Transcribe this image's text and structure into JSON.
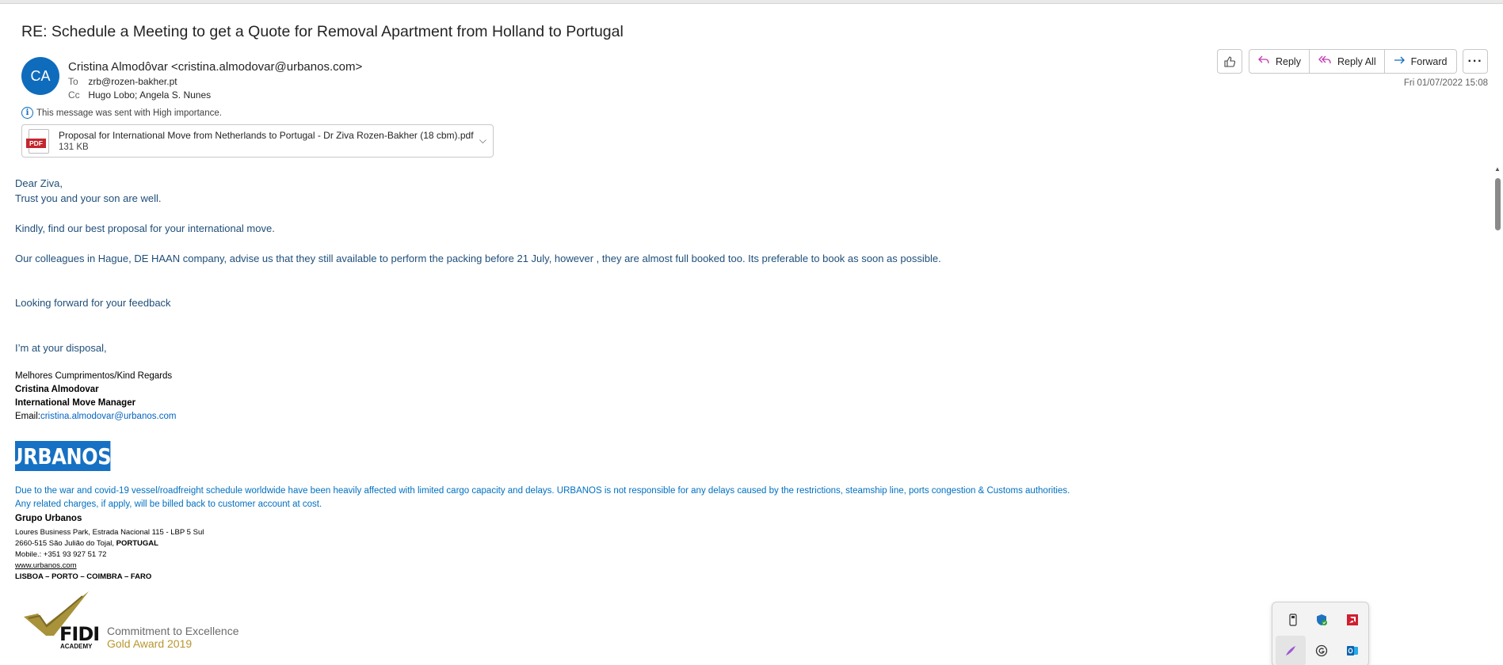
{
  "email": {
    "subject": "RE: Schedule a Meeting to get a Quote for Removal Apartment from Holland to Portugal",
    "avatar_initials": "CA",
    "avatar_color": "#0f6cbd",
    "sender": "Cristina Almodôvar <cristina.almodovar@urbanos.com>",
    "to_label": "To",
    "to": "zrb@rozen-bakher.pt",
    "cc_label": "Cc",
    "cc": "Hugo Lobo; Angela S. Nunes",
    "importance": "This message was sent with High importance.",
    "date": "Fri 01/07/2022 15:08"
  },
  "attachment": {
    "icon": "pdf-icon",
    "type_label": "PDF",
    "name": "Proposal for International Move from Netherlands to Portugal - Dr Ziva Rozen-Bakher  (18 cbm).pdf",
    "size": "131 KB"
  },
  "actions": {
    "like_icon": "thumbs-up-icon",
    "reply": "Reply",
    "reply_all": "Reply All",
    "forward": "Forward",
    "more_icon": "more-icon",
    "reply_color": "#c239b3",
    "forward_color": "#0f6cbd"
  },
  "body": {
    "greeting": "Dear Ziva,",
    "line1": "Trust you and your son are well.",
    "line2": "Kindly, find our best proposal for your international move.",
    "line3": "Our colleagues in Hague, DE HAAN company,  advise us that they still available to perform the packing before 21 July, however , they are almost full booked too. Its preferable to book as soon as possible.",
    "line4": "Looking forward for your feedback",
    "line5": "I’m at your disposal,",
    "text_color": "#1f4e79"
  },
  "signature": {
    "regards": "Melhores Cumprimentos/Kind Regards",
    "name": "Cristina Almodovar",
    "title": "International Move Manager",
    "email_label": "Email:",
    "email": "cristina.almodovar@urbanos.com",
    "logo_text": "URBANOS",
    "logo_mark": "®",
    "logo_color": "#1670c3",
    "disclaimer1": "Due to the war and covid-19 vessel/roadfreight schedule worldwide have been heavily affected with limited cargo capacity and delays. URBANOS is not responsible for any delays caused by the restrictions, steamship line, ports congestion & Customs authorities.",
    "disclaimer2": "Any related charges, if apply, will be billed back to customer account at cost.",
    "company": "Grupo Urbanos",
    "address1": "Loures Business Park, Estrada Nacional 115 - LBP 5 Sul",
    "address2_prefix": "2660-515 São Julião do Tojal, ",
    "address2_country": "PORTUGAL",
    "mobile": "Mobile.: +351 93 927 51 72",
    "website": "www.urbanos.com",
    "cities": "LISBOA – PORTO – COIMBRA – FARO",
    "fidi_brand": "FIDI",
    "fidi_sub": "ACADEMY",
    "award_line1": "Commitment to Excellence",
    "award_line2": "Gold Award 2019",
    "gold_color": "#b8962e"
  },
  "tray": {
    "icons": [
      "usb-drive-icon",
      "security-shield-icon",
      "amd-icon",
      "pen-icon",
      "grammarly-icon",
      "outlook-icon"
    ]
  }
}
